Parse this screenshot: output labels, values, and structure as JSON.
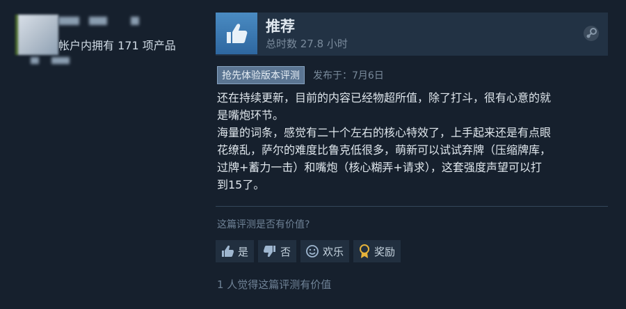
{
  "profile": {
    "owned_text": "帐户内拥有 171 项产品"
  },
  "review": {
    "verdict": "推荐",
    "hours": "总时数 27.8 小时",
    "badge": "抢先体验版本评测",
    "posted": "发布于：7月6日",
    "body_lines": [
      "还在持续更新，目前的内容已经物超所值，除了打斗，很有心意的就",
      "是嘴炮环节。",
      "海量的词条，感觉有二十个左右的核心特效了，上手起来还是有点眼",
      "花缭乱，萨尔的难度比鲁克低很多，萌新可以试试弃牌（压缩牌库，",
      "过牌+蓄力一击）和嘴炮（核心糊弄+请求），这套强度声望可以打",
      "到15了。"
    ]
  },
  "helpful": {
    "question": "这篇评测是否有价值?",
    "buttons": {
      "yes": "是",
      "no": "否",
      "funny": "欢乐",
      "award": "奖励"
    },
    "count_text": "1 人觉得这篇评测有价值"
  },
  "colors": {
    "accent_blue": "#4a8bc2",
    "badge_bg": "#5b7592",
    "award_gold": "#e6b33a"
  }
}
